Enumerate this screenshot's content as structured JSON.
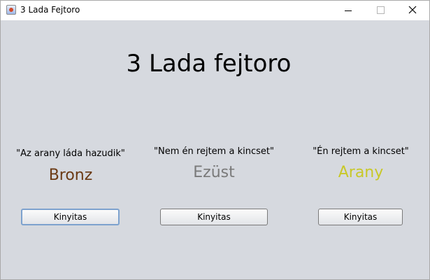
{
  "window": {
    "title": "3 Lada Fejtoro"
  },
  "main": {
    "title": "3 Lada fejtoro"
  },
  "chests": [
    {
      "quote": "\"Az arany láda hazudik\"",
      "name": "Bronz",
      "color": "#6b3a14",
      "button_label": "Kinyitas"
    },
    {
      "quote": "\"Nem én rejtem a kincset\"",
      "name": "Ezüst",
      "color": "#7a7a7a",
      "button_label": "Kinyitas"
    },
    {
      "quote": "\"Én rejtem a kincset\"",
      "name": "Arany",
      "color": "#c8c828",
      "button_label": "Kinyitas"
    }
  ],
  "icons": {
    "app": "java-app-icon",
    "minimize": "minimize-icon",
    "maximize": "maximize-icon",
    "close": "close-icon"
  }
}
